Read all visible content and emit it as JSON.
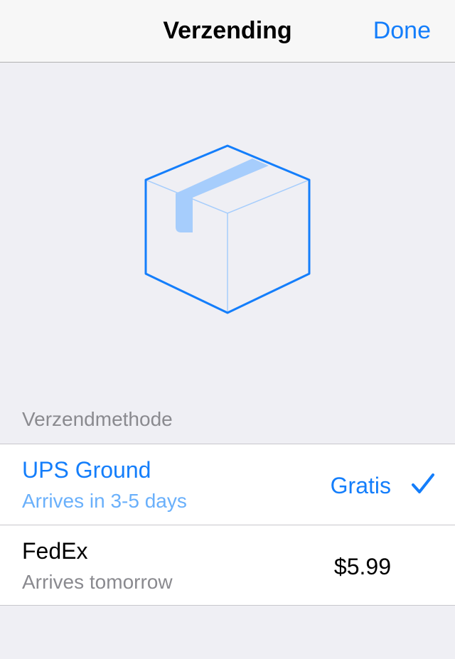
{
  "navbar": {
    "title": "Verzending",
    "done_label": "Done"
  },
  "illustration": {
    "icon": "package-box-icon",
    "color": "#147efb"
  },
  "section": {
    "header": "Verzendmethode",
    "options": [
      {
        "title": "UPS Ground",
        "subtitle": "Arrives in 3-5 days",
        "price": "Gratis",
        "selected": true
      },
      {
        "title": "FedEx",
        "subtitle": "Arrives tomorrow",
        "price": "$5.99",
        "selected": false
      }
    ]
  },
  "colors": {
    "accent": "#147efb",
    "accent_light": "#6ab0fb",
    "secondary_text": "#8a8a8f",
    "background": "#efeff4"
  }
}
